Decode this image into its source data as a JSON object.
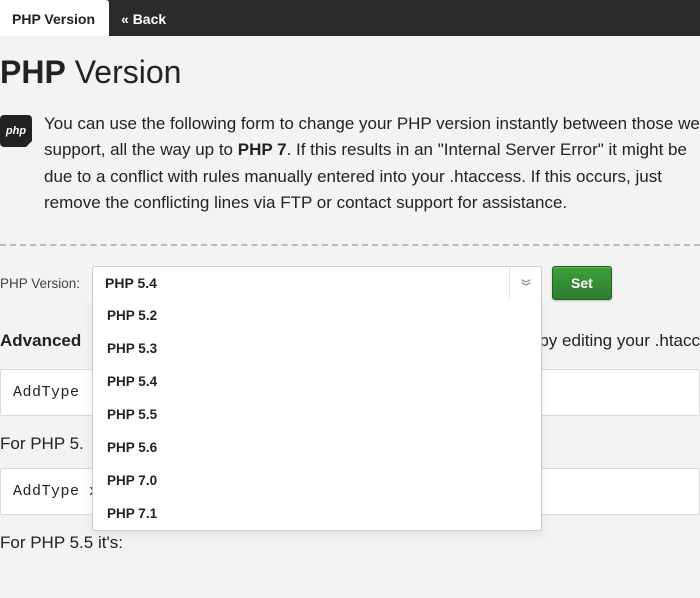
{
  "tabs": {
    "active": "PHP Version",
    "back": "« Back"
  },
  "heading": {
    "bold": "PHP",
    "rest": " Version"
  },
  "badge": "php",
  "intro": {
    "part1": "You can use the following form to change your PHP version instantly between those we support, all the way up to ",
    "bold": "PHP 7",
    "part2": ". If this results in an \"Internal Server Error\" it might be due to a conflict with rules manually entered into your .htaccess. If this occurs, just remove the conflicting lines via FTP or contact support for assistance."
  },
  "form": {
    "label": "PHP Version:",
    "selected": "PHP 5.4",
    "options": [
      "PHP 5.2",
      "PHP 5.3",
      "PHP 5.4",
      "PHP 5.5",
      "PHP 5.6",
      "PHP 7.0",
      "PHP 7.1"
    ],
    "set": "Set"
  },
  "advanced": {
    "bold": "Advanced",
    "restVisible": "rself by editing your .htacc"
  },
  "code1": "AddType",
  "sublabel1": "For PHP 5.",
  "code2": "AddType x-httpd-php54 .php",
  "sublabel2": "For PHP 5.5 it's:"
}
